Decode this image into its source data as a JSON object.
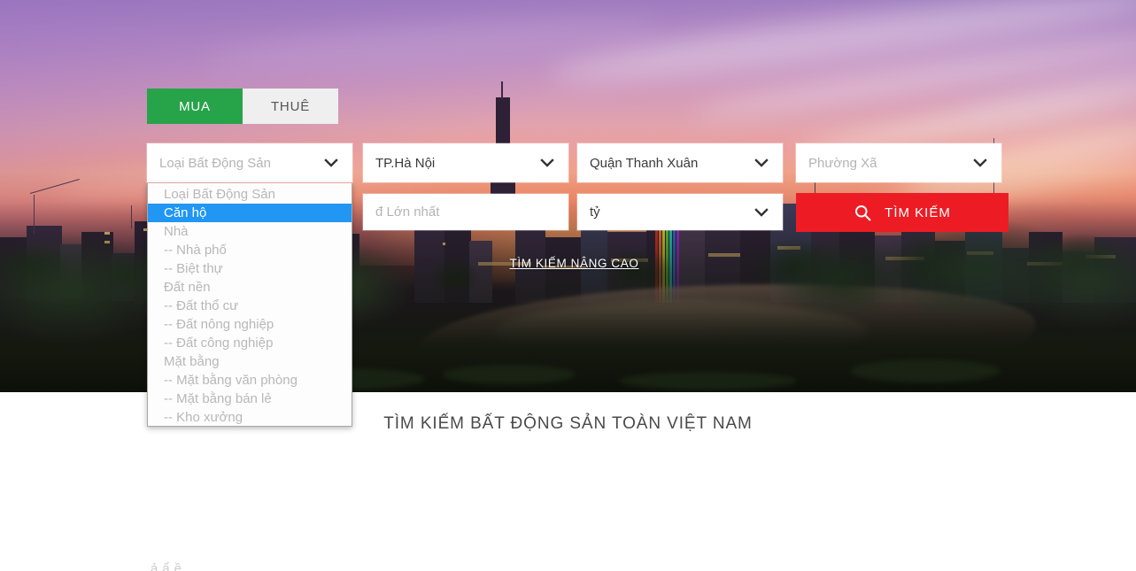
{
  "hero": {
    "tabs": [
      {
        "id": "buy",
        "label": "MUA",
        "active": true
      },
      {
        "id": "rent",
        "label": "THUÊ",
        "active": false
      }
    ],
    "fields": {
      "property_type": {
        "value": "Loại Bất Động Sản",
        "is_placeholder": true
      },
      "province": {
        "value": "TP.Hà Nội",
        "is_placeholder": false
      },
      "district": {
        "value": "Quận Thanh Xuân",
        "is_placeholder": false
      },
      "ward": {
        "value": "Phường Xã",
        "is_placeholder": true
      },
      "price_max": {
        "value": "",
        "placeholder": "đ Lớn nhất"
      },
      "price_unit": {
        "value": "tỷ",
        "is_placeholder": false
      }
    },
    "search_button": {
      "label": "TÌM KIẾM",
      "icon": "search-icon"
    },
    "advanced_link": "TÌM KIẾM NÂNG CAO",
    "dropdown": {
      "open": true,
      "selected": "Căn hộ",
      "options": [
        {
          "label": "Loại Bất Động Sản",
          "selected": false
        },
        {
          "label": "Căn hộ",
          "selected": true
        },
        {
          "label": "Nhà",
          "selected": false
        },
        {
          "label": "-- Nhà phố",
          "selected": false
        },
        {
          "label": "-- Biệt thự",
          "selected": false
        },
        {
          "label": "Đất nền",
          "selected": false
        },
        {
          "label": "-- Đất thổ cư",
          "selected": false
        },
        {
          "label": "-- Đất nông nghiệp",
          "selected": false
        },
        {
          "label": "-- Đất công nghiệp",
          "selected": false
        },
        {
          "label": "Mặt bằng",
          "selected": false
        },
        {
          "label": "-- Mặt bằng văn phòng",
          "selected": false
        },
        {
          "label": "-- Mặt bằng bán lẻ",
          "selected": false
        },
        {
          "label": "-- Kho xưởng",
          "selected": false
        }
      ]
    }
  },
  "main": {
    "section_title": "TÌM KIẾM BẤT ĐỘNG SẢN TOÀN VIỆT NAM",
    "partial_text": "ả ẩ ề"
  },
  "colors": {
    "tab_active_bg": "#27a34a",
    "tab_inactive_bg": "#efefef",
    "search_button_bg": "#ed1c24",
    "dropdown_selected_bg": "#2196f3",
    "placeholder_text": "#b4b4b4",
    "field_bg": "#ffffff",
    "section_title_text": "#4a4a4a"
  }
}
